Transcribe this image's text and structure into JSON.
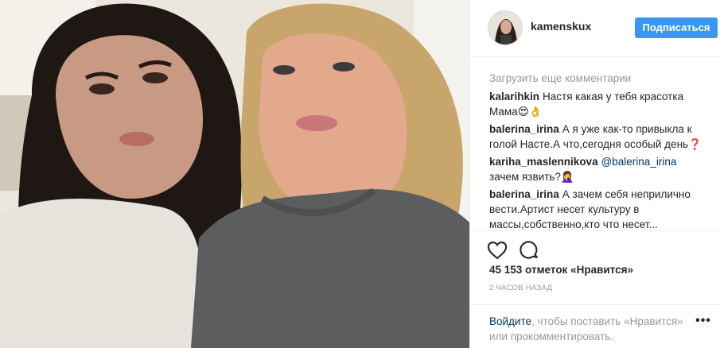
{
  "post": {
    "image_alt": "Две женщины делают селфи"
  },
  "header": {
    "username": "kamenskux",
    "follow_label": "Подписаться"
  },
  "comments": {
    "load_more": "Загрузить еще комментарии",
    "items": [
      {
        "author": "kalarihkin",
        "text": "Настя какая у тебя красотка Мама😍👌"
      },
      {
        "author": "balerina_irina",
        "text": "А я уже как-то привыкла к голой Насте.А что,сегодня особый день❓"
      },
      {
        "author": "kariha_maslennikova",
        "mention": "@balerina_irina",
        "text": "зачем язвить?🤦‍♀️"
      },
      {
        "author": "balerina_irina",
        "text": "А зачем себя неприлично вести.Артист несет культуру в массы,собственно,кто что несет..."
      }
    ]
  },
  "actions": {
    "like_icon": "heart-icon",
    "comment_icon": "comment-icon"
  },
  "likes_text": "45 153 отметок «Нравится»",
  "time_text": "2 часов назад",
  "login": {
    "link_text": "Войдите",
    "rest_text": ", чтобы поставить «Нравится» или прокомментировать.",
    "more_icon": "more-options-icon"
  },
  "colors": {
    "accent": "#3897f0",
    "link": "#003569",
    "muted": "#999999"
  }
}
